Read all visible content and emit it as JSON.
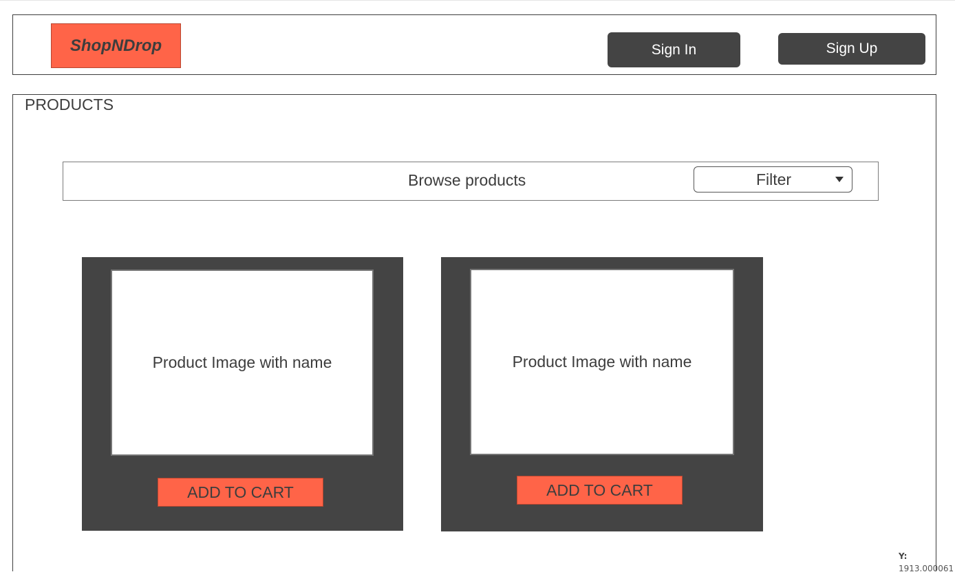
{
  "header": {
    "logo": "ShopNDrop",
    "sign_in_label": "Sign In",
    "sign_up_label": "Sign Up"
  },
  "products": {
    "title": "PRODUCTS",
    "browse_label": "Browse products",
    "filter": {
      "selected": "Filter",
      "icon": "caret-down-icon"
    },
    "cards": [
      {
        "image_label": "Product Image with name",
        "button_label": "ADD TO CART"
      },
      {
        "image_label": "Product Image with name",
        "button_label": "ADD TO CART"
      }
    ]
  },
  "status": {
    "y_label": "Y:",
    "y_value": "1913.000061"
  },
  "colors": {
    "accent": "#ff6448",
    "dark": "#444444",
    "text": "#3d3d3d",
    "background": "#ffffff"
  }
}
